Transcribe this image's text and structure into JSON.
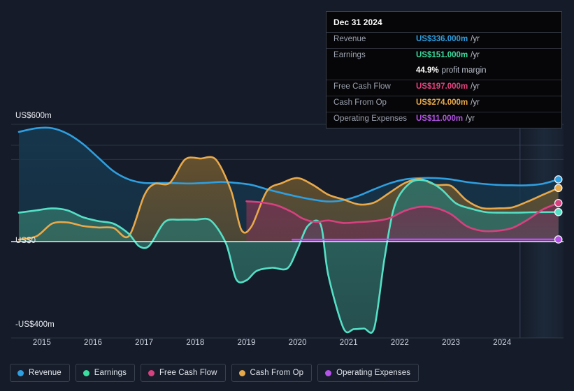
{
  "chart_data": {
    "type": "area",
    "title": "",
    "xlabel": "",
    "ylabel": "",
    "ylim": [
      -400,
      600
    ],
    "xlim": [
      2014.4,
      2025.2
    ],
    "grid": true,
    "legend_position": "bottom-left",
    "y_ticks": [
      "US$600m",
      "US$0",
      "-US$400m"
    ],
    "y_tick_values": [
      600,
      0,
      -400
    ],
    "x_ticks": [
      "2015",
      "2016",
      "2017",
      "2018",
      "2019",
      "2020",
      "2021",
      "2022",
      "2023",
      "2024"
    ],
    "x_tick_values": [
      2015,
      2016,
      2017,
      2018,
      2019,
      2020,
      2021,
      2022,
      2023,
      2024
    ],
    "forecast_start": 2024.35,
    "series": [
      {
        "name": "Revenue",
        "color": "#2e9fe0",
        "fill": "#16384f",
        "x": [
          2014.55,
          2014.9,
          2015.2,
          2015.5,
          2015.8,
          2016.1,
          2016.4,
          2016.7,
          2017.0,
          2017.3,
          2017.6,
          2017.9,
          2018.2,
          2018.5,
          2018.8,
          2019.1,
          2019.4,
          2019.7,
          2020.0,
          2020.3,
          2020.6,
          2020.9,
          2021.2,
          2021.5,
          2021.8,
          2022.1,
          2022.4,
          2022.7,
          2023.0,
          2023.3,
          2023.6,
          2023.9,
          2024.2,
          2024.5,
          2024.8,
          2025.1
        ],
        "values": [
          561,
          580,
          580,
          552,
          500,
          430,
          360,
          318,
          300,
          300,
          299,
          297,
          300,
          305,
          300,
          290,
          268,
          248,
          230,
          215,
          205,
          212,
          235,
          268,
          298,
          318,
          325,
          325,
          318,
          305,
          296,
          290,
          288,
          288,
          296,
          318
        ]
      },
      {
        "name": "Earnings",
        "color": "#55e0c6",
        "fill": "#2f6e66",
        "x": [
          2014.55,
          2014.9,
          2015.2,
          2015.5,
          2015.8,
          2016.1,
          2016.4,
          2016.7,
          2016.9,
          2017.1,
          2017.4,
          2017.7,
          2018.0,
          2018.3,
          2018.6,
          2018.8,
          2019.0,
          2019.2,
          2019.5,
          2019.8,
          2020.0,
          2020.2,
          2020.45,
          2020.6,
          2020.9,
          2021.1,
          2021.3,
          2021.5,
          2021.7,
          2021.9,
          2022.2,
          2022.5,
          2022.8,
          2023.1,
          2023.4,
          2023.7,
          2024.0,
          2024.3,
          2024.6,
          2025.1
        ],
        "values": [
          148,
          160,
          170,
          160,
          125,
          105,
          92,
          40,
          -22,
          -20,
          100,
          112,
          112,
          108,
          -9,
          -180,
          -185,
          -140,
          -125,
          -128,
          -35,
          80,
          88,
          -160,
          -415,
          -418,
          -415,
          -412,
          -80,
          185,
          300,
          312,
          270,
          195,
          168,
          150,
          148,
          148,
          150,
          151
        ]
      },
      {
        "name": "Free Cash Flow",
        "color": "#d7417f",
        "fill": "#6e3550",
        "x": [
          2019.0,
          2019.3,
          2019.6,
          2019.9,
          2020.1,
          2020.35,
          2020.6,
          2020.9,
          2021.2,
          2021.5,
          2021.8,
          2022.1,
          2022.4,
          2022.7,
          2023.0,
          2023.3,
          2023.6,
          2023.9,
          2024.2,
          2024.5,
          2024.8,
          2025.1
        ],
        "values": [
          206,
          200,
          185,
          150,
          118,
          100,
          108,
          95,
          100,
          105,
          120,
          158,
          178,
          172,
          140,
          80,
          55,
          55,
          70,
          112,
          165,
          197
        ]
      },
      {
        "name": "Cash From Op",
        "color": "#e8a94a",
        "fill": "#6a5530",
        "x": [
          2014.55,
          2014.9,
          2015.2,
          2015.5,
          2015.8,
          2016.1,
          2016.4,
          2016.7,
          2017.0,
          2017.2,
          2017.5,
          2017.8,
          2018.1,
          2018.4,
          2018.7,
          2018.9,
          2019.1,
          2019.4,
          2019.7,
          2020.0,
          2020.3,
          2020.6,
          2020.9,
          2021.2,
          2021.5,
          2021.8,
          2022.1,
          2022.4,
          2022.7,
          2023.0,
          2023.3,
          2023.6,
          2023.9,
          2024.2,
          2024.5,
          2024.8,
          2025.1
        ],
        "values": [
          10,
          28,
          92,
          98,
          80,
          72,
          70,
          28,
          235,
          295,
          300,
          420,
          425,
          420,
          260,
          60,
          78,
          258,
          300,
          325,
          290,
          240,
          215,
          190,
          200,
          250,
          300,
          320,
          290,
          285,
          212,
          172,
          170,
          175,
          205,
          240,
          274
        ]
      },
      {
        "name": "Operating Expenses",
        "color": "#b552e8",
        "fill": "#5a3470",
        "x": [
          2019.9,
          2021.0,
          2022.0,
          2023.0,
          2024.0,
          2025.1
        ],
        "values": [
          10,
          10,
          11,
          11,
          11,
          11
        ]
      }
    ]
  },
  "tooltip": {
    "date": "Dec 31 2024",
    "rows": [
      {
        "label": "Revenue",
        "value": "US$336.000m",
        "unit": "/yr",
        "color": "#2e9fe0"
      },
      {
        "label": "Earnings",
        "value": "US$151.000m",
        "unit": "/yr",
        "color": "#3ddca0"
      },
      {
        "label": "",
        "value": "44.9%",
        "unit": "profit margin",
        "color": "#ffffff",
        "sub": true
      },
      {
        "label": "Free Cash Flow",
        "value": "US$197.000m",
        "unit": "/yr",
        "color": "#e8417f"
      },
      {
        "label": "Cash From Op",
        "value": "US$274.000m",
        "unit": "/yr",
        "color": "#e8a94a"
      },
      {
        "label": "Operating Expenses",
        "value": "US$11.000m",
        "unit": "/yr",
        "color": "#b552e8"
      }
    ]
  },
  "legend": {
    "items": [
      {
        "label": "Revenue",
        "color": "#2e9fe0"
      },
      {
        "label": "Earnings",
        "color": "#3ddca0"
      },
      {
        "label": "Free Cash Flow",
        "color": "#d7417f"
      },
      {
        "label": "Cash From Op",
        "color": "#e8a94a"
      },
      {
        "label": "Operating Expenses",
        "color": "#b552e8"
      }
    ]
  },
  "colors": {
    "background": "#151b28",
    "gridline": "#2c3444",
    "zero_axis": "#e9ecf2",
    "tooltip_bg": "#060608"
  }
}
